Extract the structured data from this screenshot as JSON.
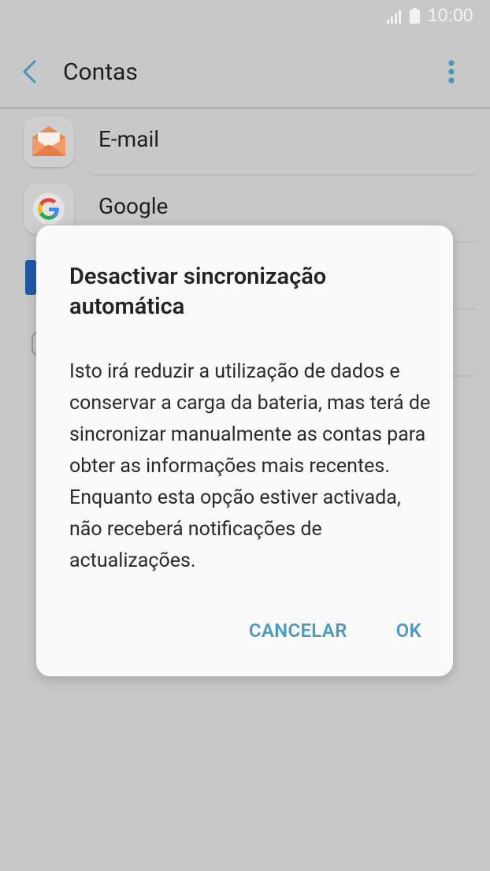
{
  "status_bar": {
    "time": "10:00",
    "icons": [
      "signal-icon",
      "battery-icon"
    ]
  },
  "app_bar": {
    "title": "Contas",
    "icons": [
      "back-arrow-icon",
      "more-options-icon"
    ]
  },
  "accounts": [
    {
      "label": "E-mail",
      "icon": "email-envelope-icon"
    },
    {
      "label": "Google",
      "icon": "google-g-icon"
    }
  ],
  "dialog": {
    "title": "Desactivar sincronização automática",
    "message": "Isto irá reduzir a utilização de dados e conservar a carga da bateria, mas terá de sincronizar manualmente as contas para obter as informações mais recentes. Enquanto esta opção estiver activada, não receberá notificações de actualizações.",
    "cancel_label": "CANCELAR",
    "ok_label": "OK"
  },
  "colors": {
    "dimmed_background": "#c8c8c8",
    "dialog_background": "#fafafa",
    "accent": "#4a9ac4",
    "title_text": "#1f1f1f"
  }
}
